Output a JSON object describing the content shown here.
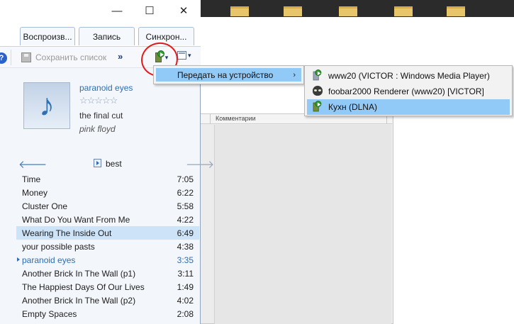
{
  "window": {
    "minimize_glyph": "—",
    "maximize_glyph": "☐",
    "close_glyph": "✕"
  },
  "tabs": [
    {
      "label": "Воспроизв..."
    },
    {
      "label": "Запись"
    },
    {
      "label": "Синхрон..."
    }
  ],
  "toolbar": {
    "help_glyph": "?",
    "save_list_label": "Сохранить список",
    "more_glyph": "»",
    "cast_caret": "▾",
    "options_caret": "▾"
  },
  "now_playing": {
    "title": "paranoid eyes",
    "rating_stars": "☆☆☆☆☆",
    "album": "the final cut",
    "artist": "pink floyd",
    "note_glyph": "♪"
  },
  "playlist": {
    "name": "best",
    "back_glyph": "🡐",
    "forward_glyph": "🡒",
    "tracks": [
      {
        "name": "Time",
        "duration": "7:05"
      },
      {
        "name": "Money",
        "duration": "6:22"
      },
      {
        "name": "Cluster One",
        "duration": "5:58"
      },
      {
        "name": "What Do You Want From Me",
        "duration": "4:22"
      },
      {
        "name": "Wearing The Inside Out",
        "duration": "6:49"
      },
      {
        "name": "your possible pasts",
        "duration": "4:38"
      },
      {
        "name": "paranoid eyes",
        "duration": "3:35"
      },
      {
        "name": "Another Brick In The Wall (p1)",
        "duration": "3:11"
      },
      {
        "name": "The Happiest Days Of Our Lives",
        "duration": "1:49"
      },
      {
        "name": "Another Brick In The Wall (p2)",
        "duration": "4:02"
      },
      {
        "name": "Empty Spaces",
        "duration": "2:08"
      }
    ]
  },
  "context_menu": {
    "item_label": "Передать на устройство",
    "submenu_arrow": "›"
  },
  "devices_menu": [
    {
      "label": "www20 (VICTOR : Windows Media Player)"
    },
    {
      "label": "foobar2000 Renderer (www20) [VICTOR]"
    },
    {
      "label": "Кухн (DLNA)"
    }
  ],
  "background": {
    "column_header": "Комментарии"
  }
}
